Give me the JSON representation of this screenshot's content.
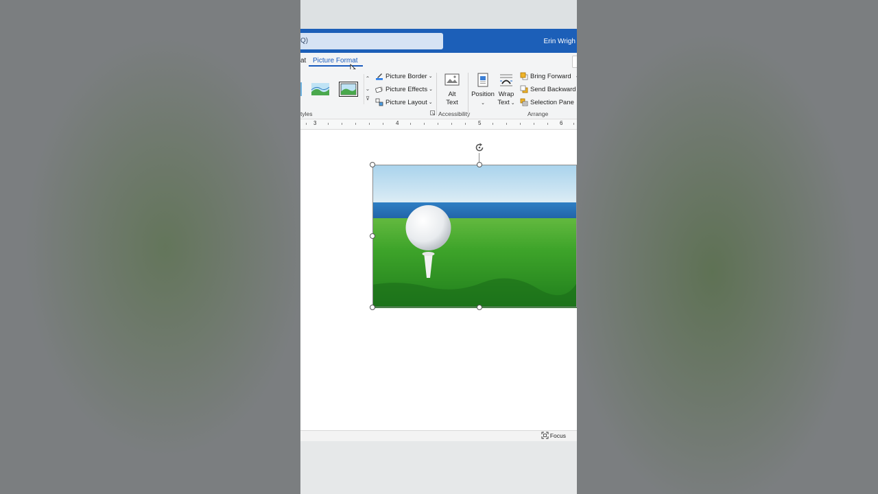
{
  "title_bar": {
    "search_text": "Q)",
    "user_name": "Erin Wrigh"
  },
  "tabs": [
    {
      "label": "at",
      "active": false
    },
    {
      "label": "Picture Format",
      "active": true
    }
  ],
  "ribbon": {
    "picture_styles": {
      "group_label": "tyles"
    },
    "picture_commands": {
      "border": "Picture Border",
      "effects": "Picture Effects",
      "layout": "Picture Layout"
    },
    "accessibility": {
      "alt_text_line1": "Alt",
      "alt_text_line2": "Text",
      "group_label": "Accessibility"
    },
    "arrange": {
      "position": "Position",
      "wrap_line1": "Wrap",
      "wrap_line2": "Text",
      "bring_forward": "Bring Forward",
      "send_backward": "Send Backward",
      "selection_pane": "Selection Pane",
      "group_label": "Arrange"
    }
  },
  "ruler": {
    "numbers": [
      "3",
      "4",
      "5",
      "6"
    ]
  },
  "status_bar": {
    "focus": "Focus"
  },
  "colors": {
    "title_bar": "#1c5fb8",
    "accent": "#185abd",
    "ribbon_bg": "#f3f4f5"
  },
  "document": {
    "image": "golf-ball-on-tee",
    "selected": true
  }
}
